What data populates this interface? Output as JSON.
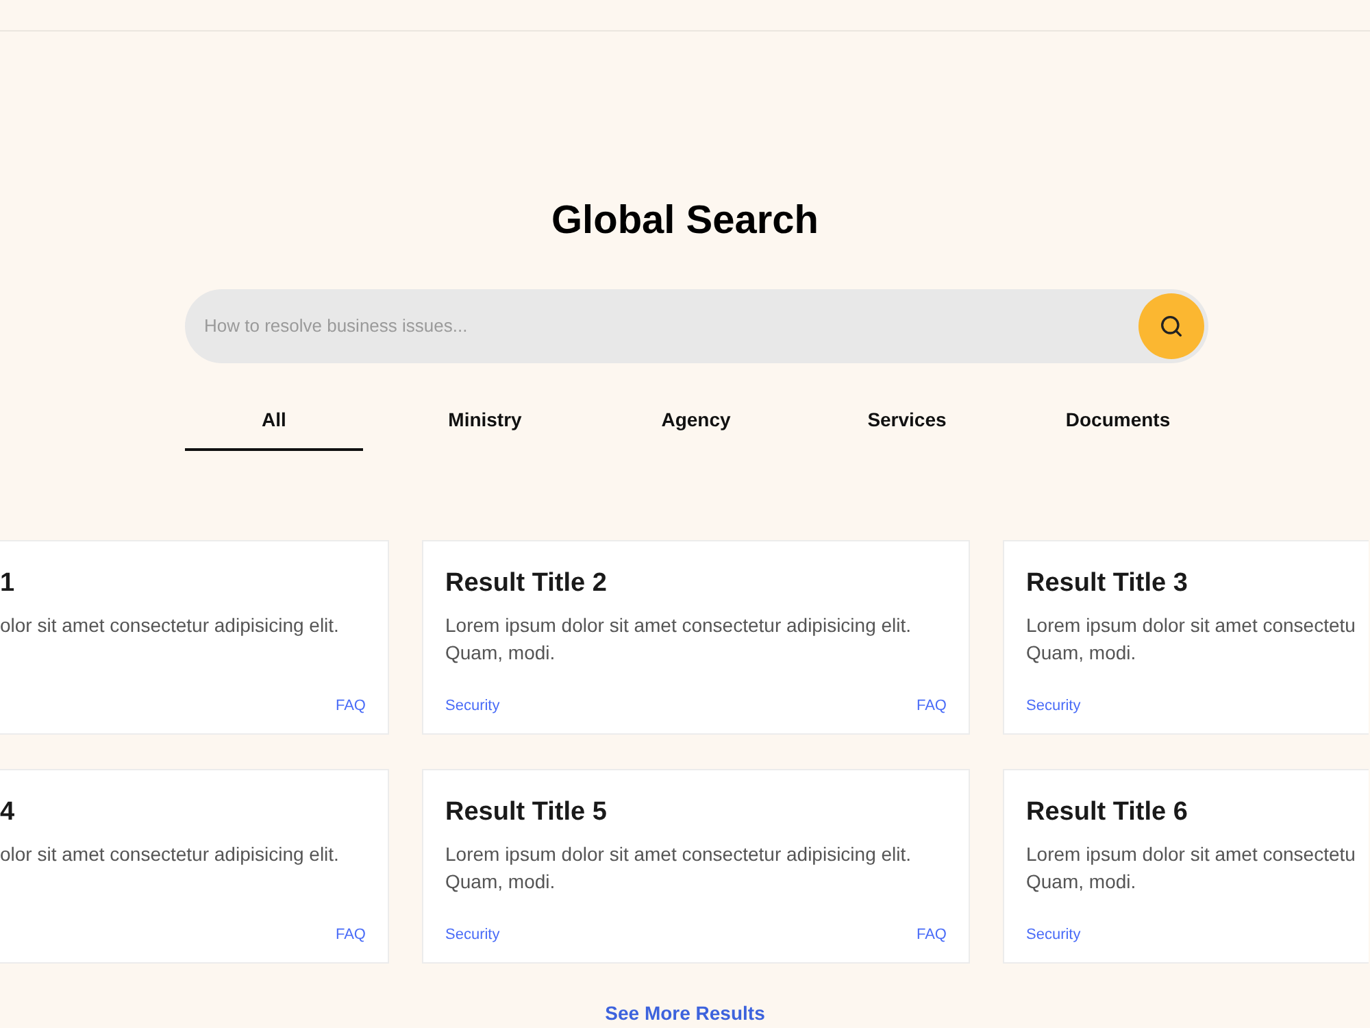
{
  "title": "Global Search",
  "search": {
    "placeholder": "How to resolve business issues..."
  },
  "tabs": [
    {
      "label": "All",
      "selected": true
    },
    {
      "label": "Ministry",
      "selected": false
    },
    {
      "label": "Agency",
      "selected": false
    },
    {
      "label": "Services",
      "selected": false
    },
    {
      "label": "Documents",
      "selected": false
    }
  ],
  "results": [
    {
      "title": "1",
      "description": [
        "olor sit amet consectetur adipisicing elit."
      ],
      "type": "FAQ"
    },
    {
      "title": "Result Title 2",
      "description": [
        "Lorem ipsum dolor sit amet consectetur adipisicing elit.",
        "Quam, modi."
      ],
      "category": "Security",
      "type": "FAQ"
    },
    {
      "title": "Result Title 3",
      "description": [
        "Lorem ipsum dolor sit amet consectetu",
        "Quam, modi."
      ],
      "category": "Security"
    },
    {
      "title": "4",
      "description": [
        "olor sit amet consectetur adipisicing elit."
      ],
      "type": "FAQ"
    },
    {
      "title": "Result Title 5",
      "description": [
        "Lorem ipsum dolor sit amet consectetur adipisicing elit.",
        "Quam, modi."
      ],
      "category": "Security",
      "type": "FAQ"
    },
    {
      "title": "Result Title 6",
      "description": [
        "Lorem ipsum dolor sit amet consectetu",
        "Quam, modi."
      ],
      "category": "Security"
    }
  ],
  "more_link": "See More Results"
}
